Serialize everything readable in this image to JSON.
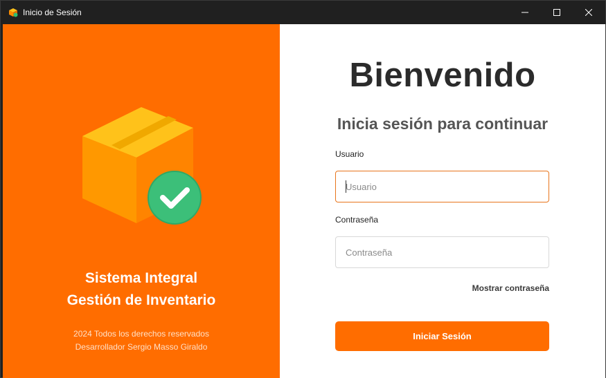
{
  "window": {
    "title": "Inicio de Sesión"
  },
  "left_panel": {
    "brand_line1": "Sistema Integral",
    "brand_line2": "Gestión de Inventario",
    "footer_line1": "2024 Todos los derechos reservados",
    "footer_line2": "Desarrollador Sergio Masso Giraldo",
    "background_color": "#ff6d00",
    "illustration_icon": "package-check-icon"
  },
  "login": {
    "welcome": "Bienvenido",
    "subtitle": "Inicia sesión para continuar",
    "username_label": "Usuario",
    "username_placeholder": "Usuario",
    "username_value": "",
    "password_label": "Contraseña",
    "password_placeholder": "Contraseña",
    "password_value": "",
    "show_password": "Mostrar contraseña",
    "submit": "Iniciar Sesión",
    "accent_color": "#ff6d00"
  }
}
